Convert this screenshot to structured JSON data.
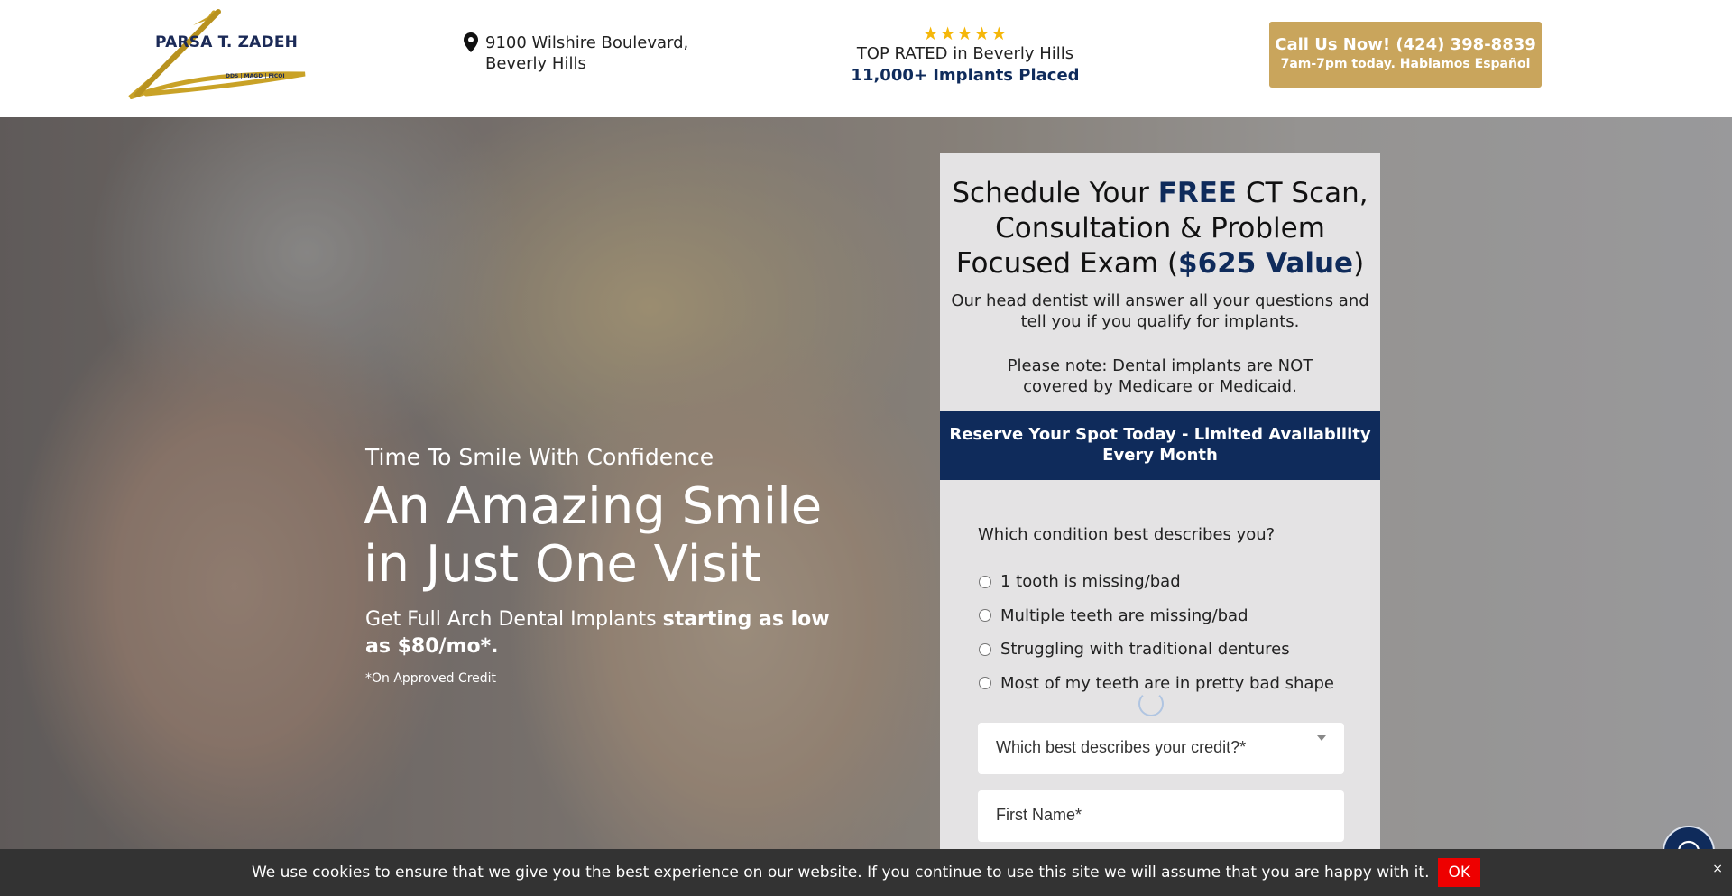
{
  "header": {
    "logo": {
      "name": "PARSA T. ZADEH",
      "credentials": "DDS | MAGD | FICOI"
    },
    "address": "9100 Wilshire Boulevard, Beverly Hills",
    "rating": {
      "stars": 5,
      "stars_text": "★★★★★",
      "label": "TOP RATED in Beverly Hills",
      "implants": "11,000+ Implants Placed"
    },
    "call": {
      "label": "Call Us Now! (424) 398-8839",
      "sub": "7am-7pm today. Hablamos Español"
    }
  },
  "hero": {
    "subtitle": "Time To Smile With Confidence",
    "title": "An Amazing Smile in Just One Visit",
    "offer_prefix": "Get Full Arch Dental Implants ",
    "offer_bold": "starting as low as $80/mo*.",
    "note": "*On Approved Credit"
  },
  "form": {
    "title_part1": "Schedule Your ",
    "title_free": "FREE",
    "title_part2": " CT Scan, Consultation & Problem Focused Exam (",
    "title_value": "$625 Value",
    "title_part3": ")",
    "description": "Our head dentist will answer all your questions and tell you if you qualify for implants.",
    "note": "Please note: Dental implants are NOT covered by Medicare or Medicaid.",
    "reserve_banner": "Reserve Your Spot Today - Limited Availability Every Month",
    "question": "Which condition best describes you?",
    "options": [
      "1 tooth is missing/bad",
      "Multiple teeth are missing/bad",
      "Struggling with traditional dentures",
      "Most of my teeth are in pretty bad shape"
    ],
    "credit_select": {
      "placeholder": "Which best describes your credit?*"
    },
    "first_name": {
      "placeholder": "First Name*"
    }
  },
  "cookie": {
    "text": "We use cookies to ensure that we give you the best experience on our website. If you continue to use this site we will assume that you are happy with it.",
    "ok_label": "OK",
    "close_label": "×"
  },
  "colors": {
    "navy": "#0f2b5b",
    "gold": "#c9a55c",
    "star": "#f5b70a",
    "cookie_ok": "#ee0000"
  }
}
